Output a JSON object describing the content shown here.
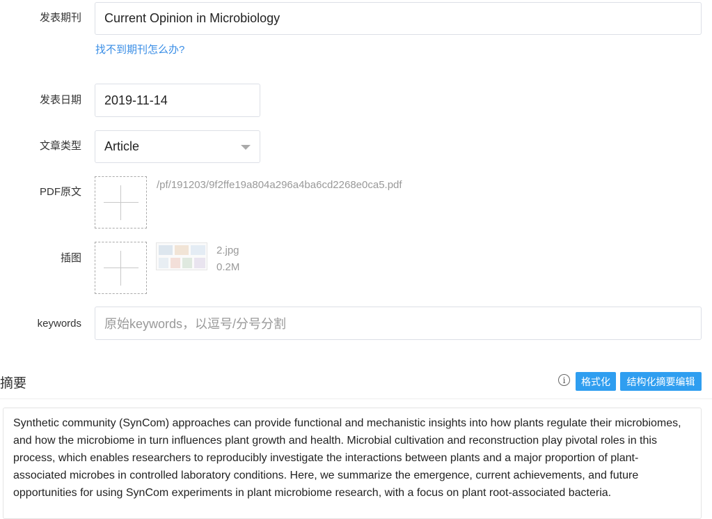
{
  "journal": {
    "label": "发表期刊",
    "value": "Current Opinion in Microbiology",
    "help_link": "找不到期刊怎么办?"
  },
  "publish_date": {
    "label": "发表日期",
    "value": "2019-11-14"
  },
  "article_type": {
    "label": "文章类型",
    "selected": "Article"
  },
  "pdf": {
    "label": "PDF原文",
    "file_path": "/pf/191203/9f2ffe19a804a296a4ba6cd2268e0ca5.pdf"
  },
  "figure": {
    "label": "插图",
    "file_name": "2.jpg",
    "file_size": "0.2M"
  },
  "keywords": {
    "label": "keywords",
    "placeholder": "原始keywords，以逗号/分号分割"
  },
  "abstract": {
    "title": "摘要",
    "info_icon": "info-icon",
    "format_button": "格式化",
    "structured_edit_button": "结构化摘要编辑",
    "button_color": "#2f9ef0",
    "text": "Synthetic community (SynCom) approaches can provide functional and mechanistic insights into how plants regulate their microbiomes, and how the microbiome in turn influences plant growth and health. Microbial cultivation and reconstruction play pivotal roles in this process, which enables researchers to reproducibly investigate the interactions between plants and a major proportion of plant-associated microbes in controlled laboratory conditions. Here, we summarize the emergence, current achievements, and future opportunities for using SynCom experiments in plant microbiome research, with a focus on plant root-associated bacteria."
  }
}
